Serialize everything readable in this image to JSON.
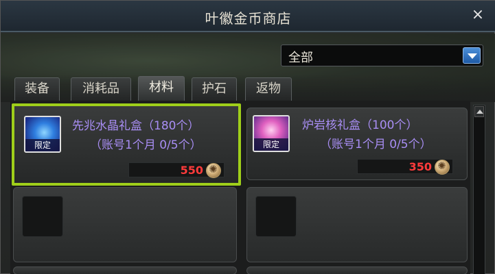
{
  "window": {
    "title": "叶徽金币商店",
    "close_label": "×"
  },
  "filter": {
    "selected": "全部"
  },
  "tabs": [
    {
      "label": "装备"
    },
    {
      "label": "消耗品"
    },
    {
      "label": "材料"
    },
    {
      "label": "护石"
    },
    {
      "label": "返物"
    }
  ],
  "items": [
    {
      "name": "先兆水晶礼盒（180个）",
      "limit": "（账号1个月 0/5个）",
      "badge": "限定",
      "price": "550",
      "icon_colors": [
        "#1c2f8a",
        "#4fb2ff"
      ]
    },
    {
      "name": "炉岩核礼盒（100个）",
      "limit": "（账号1个月 0/5个）",
      "badge": "限定",
      "price": "350",
      "icon_colors": [
        "#3c1c5a",
        "#ff78c8"
      ]
    }
  ],
  "colors": {
    "highlight": "#9fcf1a",
    "item_name": "#a98ef5",
    "price": "#ff3b3b"
  }
}
